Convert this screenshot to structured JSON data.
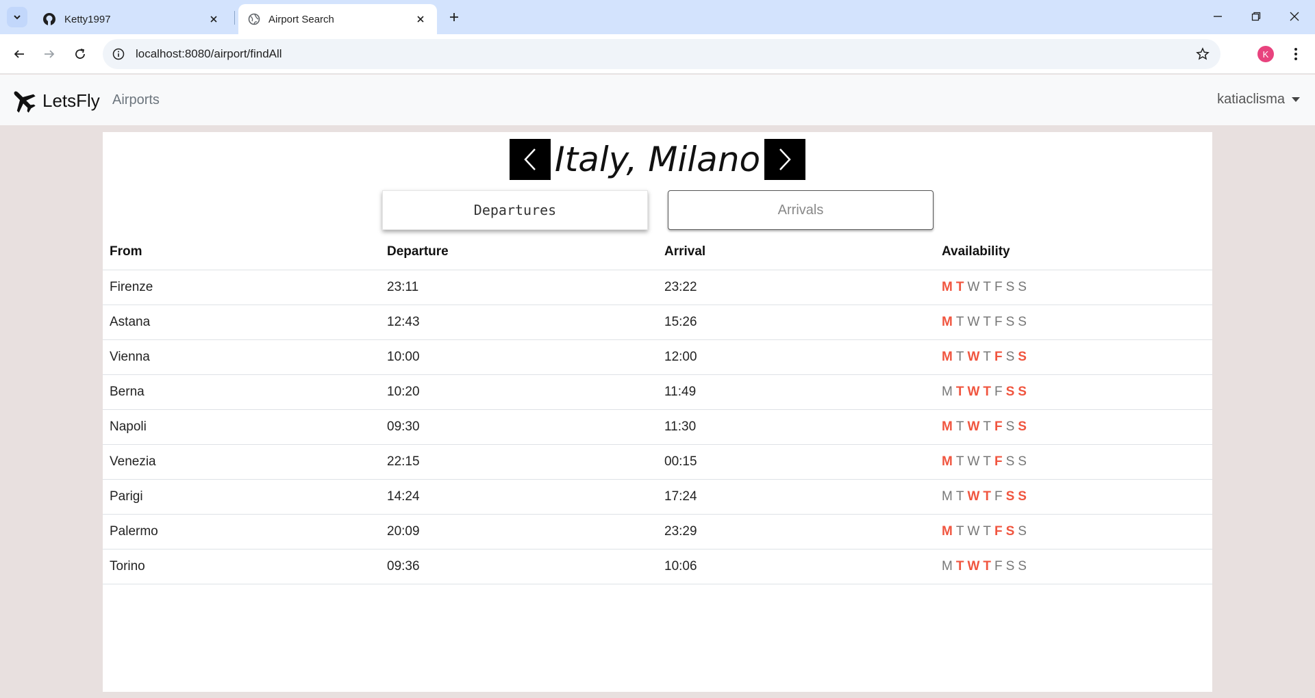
{
  "browser": {
    "tabs": [
      {
        "title": "Ketty1997",
        "icon": "github-icon"
      },
      {
        "title": "Airport Search",
        "icon": "globe-icon"
      }
    ],
    "url": "localhost:8080/airport/findAll",
    "profile_initial": "K"
  },
  "navbar": {
    "brand": "LetsFly",
    "links": [
      "Airports"
    ],
    "user": "katiaclisma"
  },
  "header": {
    "title": "Italy, Milano"
  },
  "toggle": {
    "departures": "Departures",
    "arrivals": "Arrivals"
  },
  "table": {
    "columns": [
      "From",
      "Departure",
      "Arrival",
      "Availability"
    ],
    "day_letters": [
      "M",
      "T",
      "W",
      "T",
      "F",
      "S",
      "S"
    ],
    "rows": [
      {
        "from": "Firenze",
        "departure": "23:11",
        "arrival": "23:22",
        "days": [
          1,
          1,
          0,
          0,
          0,
          0,
          0
        ]
      },
      {
        "from": "Astana",
        "departure": "12:43",
        "arrival": "15:26",
        "days": [
          1,
          0,
          0,
          0,
          0,
          0,
          0
        ]
      },
      {
        "from": "Vienna",
        "departure": "10:00",
        "arrival": "12:00",
        "days": [
          1,
          0,
          1,
          0,
          1,
          0,
          1
        ]
      },
      {
        "from": "Berna",
        "departure": "10:20",
        "arrival": "11:49",
        "days": [
          0,
          1,
          1,
          1,
          0,
          1,
          1
        ]
      },
      {
        "from": "Napoli",
        "departure": "09:30",
        "arrival": "11:30",
        "days": [
          1,
          0,
          1,
          0,
          1,
          0,
          1
        ]
      },
      {
        "from": "Venezia",
        "departure": "22:15",
        "arrival": "00:15",
        "days": [
          1,
          0,
          0,
          0,
          1,
          0,
          0
        ]
      },
      {
        "from": "Parigi",
        "departure": "14:24",
        "arrival": "17:24",
        "days": [
          0,
          0,
          1,
          1,
          0,
          1,
          1
        ]
      },
      {
        "from": "Palermo",
        "departure": "20:09",
        "arrival": "23:29",
        "days": [
          1,
          0,
          0,
          0,
          1,
          1,
          0
        ]
      },
      {
        "from": "Torino",
        "departure": "09:36",
        "arrival": "10:06",
        "days": [
          0,
          1,
          1,
          1,
          0,
          0,
          0
        ]
      }
    ]
  },
  "colors": {
    "available": "#f0553f",
    "unavailable": "#777777"
  }
}
